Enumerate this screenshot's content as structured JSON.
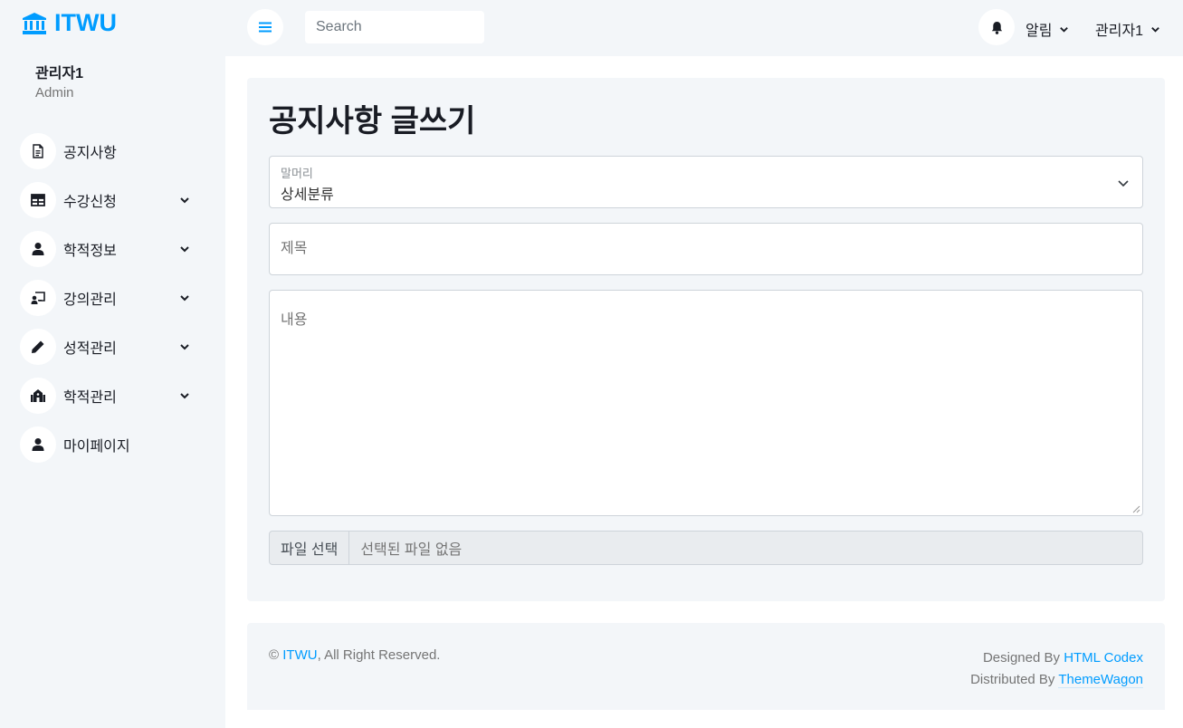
{
  "brand": {
    "name": "ITWU"
  },
  "profile": {
    "name": "관리자1",
    "role": "Admin"
  },
  "sidebar": {
    "items": [
      {
        "label": "공지사항",
        "icon": "file-icon",
        "has_sub": false
      },
      {
        "label": "수강신청",
        "icon": "table-icon",
        "has_sub": true
      },
      {
        "label": "학적정보",
        "icon": "user-icon",
        "has_sub": true
      },
      {
        "label": "강의관리",
        "icon": "chalkboard-teacher-icon",
        "has_sub": true
      },
      {
        "label": "성적관리",
        "icon": "pencil-icon",
        "has_sub": true
      },
      {
        "label": "학적관리",
        "icon": "school-icon",
        "has_sub": true
      },
      {
        "label": "마이페이지",
        "icon": "user-icon",
        "has_sub": false
      }
    ]
  },
  "topbar": {
    "search_placeholder": "Search",
    "notifications_label": "알림",
    "user_label": "관리자1"
  },
  "form": {
    "title": "공지사항 글쓰기",
    "category_label": "말머리",
    "category_value": "상세분류",
    "subject_placeholder": "제목",
    "content_placeholder": "내용",
    "file_button": "파일 선택",
    "file_status": "선택된 파일 없음"
  },
  "footer": {
    "copyright_symbol": "©",
    "brand_link": "ITWU",
    "rights": ", All Right Reserved.",
    "designed_by": "Designed By",
    "designer_link": "HTML Codex",
    "distributed_by": "Distributed By",
    "distributor_link": "ThemeWagon"
  },
  "colors": {
    "accent": "#009cff",
    "sidebar_bg": "#f3f6f9",
    "text_dark": "#191c24"
  }
}
